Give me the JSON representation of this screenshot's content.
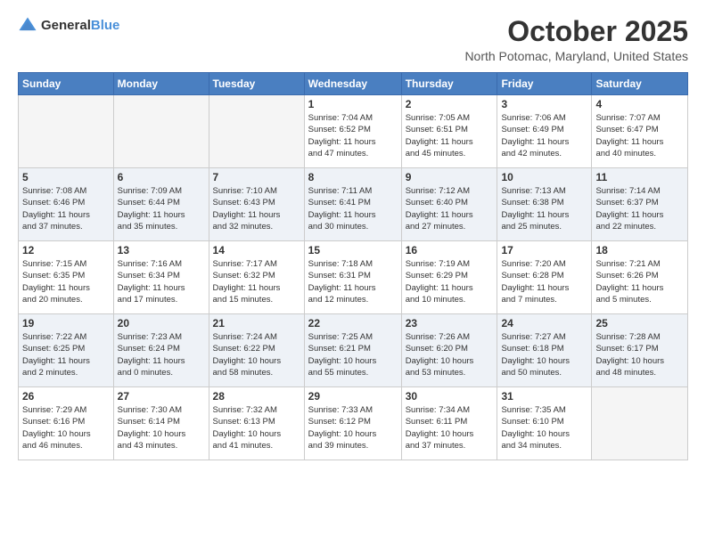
{
  "header": {
    "logo_general": "General",
    "logo_blue": "Blue",
    "month": "October 2025",
    "location": "North Potomac, Maryland, United States"
  },
  "weekdays": [
    "Sunday",
    "Monday",
    "Tuesday",
    "Wednesday",
    "Thursday",
    "Friday",
    "Saturday"
  ],
  "weeks": [
    [
      {
        "day": "",
        "info": ""
      },
      {
        "day": "",
        "info": ""
      },
      {
        "day": "",
        "info": ""
      },
      {
        "day": "1",
        "info": "Sunrise: 7:04 AM\nSunset: 6:52 PM\nDaylight: 11 hours\nand 47 minutes."
      },
      {
        "day": "2",
        "info": "Sunrise: 7:05 AM\nSunset: 6:51 PM\nDaylight: 11 hours\nand 45 minutes."
      },
      {
        "day": "3",
        "info": "Sunrise: 7:06 AM\nSunset: 6:49 PM\nDaylight: 11 hours\nand 42 minutes."
      },
      {
        "day": "4",
        "info": "Sunrise: 7:07 AM\nSunset: 6:47 PM\nDaylight: 11 hours\nand 40 minutes."
      }
    ],
    [
      {
        "day": "5",
        "info": "Sunrise: 7:08 AM\nSunset: 6:46 PM\nDaylight: 11 hours\nand 37 minutes."
      },
      {
        "day": "6",
        "info": "Sunrise: 7:09 AM\nSunset: 6:44 PM\nDaylight: 11 hours\nand 35 minutes."
      },
      {
        "day": "7",
        "info": "Sunrise: 7:10 AM\nSunset: 6:43 PM\nDaylight: 11 hours\nand 32 minutes."
      },
      {
        "day": "8",
        "info": "Sunrise: 7:11 AM\nSunset: 6:41 PM\nDaylight: 11 hours\nand 30 minutes."
      },
      {
        "day": "9",
        "info": "Sunrise: 7:12 AM\nSunset: 6:40 PM\nDaylight: 11 hours\nand 27 minutes."
      },
      {
        "day": "10",
        "info": "Sunrise: 7:13 AM\nSunset: 6:38 PM\nDaylight: 11 hours\nand 25 minutes."
      },
      {
        "day": "11",
        "info": "Sunrise: 7:14 AM\nSunset: 6:37 PM\nDaylight: 11 hours\nand 22 minutes."
      }
    ],
    [
      {
        "day": "12",
        "info": "Sunrise: 7:15 AM\nSunset: 6:35 PM\nDaylight: 11 hours\nand 20 minutes."
      },
      {
        "day": "13",
        "info": "Sunrise: 7:16 AM\nSunset: 6:34 PM\nDaylight: 11 hours\nand 17 minutes."
      },
      {
        "day": "14",
        "info": "Sunrise: 7:17 AM\nSunset: 6:32 PM\nDaylight: 11 hours\nand 15 minutes."
      },
      {
        "day": "15",
        "info": "Sunrise: 7:18 AM\nSunset: 6:31 PM\nDaylight: 11 hours\nand 12 minutes."
      },
      {
        "day": "16",
        "info": "Sunrise: 7:19 AM\nSunset: 6:29 PM\nDaylight: 11 hours\nand 10 minutes."
      },
      {
        "day": "17",
        "info": "Sunrise: 7:20 AM\nSunset: 6:28 PM\nDaylight: 11 hours\nand 7 minutes."
      },
      {
        "day": "18",
        "info": "Sunrise: 7:21 AM\nSunset: 6:26 PM\nDaylight: 11 hours\nand 5 minutes."
      }
    ],
    [
      {
        "day": "19",
        "info": "Sunrise: 7:22 AM\nSunset: 6:25 PM\nDaylight: 11 hours\nand 2 minutes."
      },
      {
        "day": "20",
        "info": "Sunrise: 7:23 AM\nSunset: 6:24 PM\nDaylight: 11 hours\nand 0 minutes."
      },
      {
        "day": "21",
        "info": "Sunrise: 7:24 AM\nSunset: 6:22 PM\nDaylight: 10 hours\nand 58 minutes."
      },
      {
        "day": "22",
        "info": "Sunrise: 7:25 AM\nSunset: 6:21 PM\nDaylight: 10 hours\nand 55 minutes."
      },
      {
        "day": "23",
        "info": "Sunrise: 7:26 AM\nSunset: 6:20 PM\nDaylight: 10 hours\nand 53 minutes."
      },
      {
        "day": "24",
        "info": "Sunrise: 7:27 AM\nSunset: 6:18 PM\nDaylight: 10 hours\nand 50 minutes."
      },
      {
        "day": "25",
        "info": "Sunrise: 7:28 AM\nSunset: 6:17 PM\nDaylight: 10 hours\nand 48 minutes."
      }
    ],
    [
      {
        "day": "26",
        "info": "Sunrise: 7:29 AM\nSunset: 6:16 PM\nDaylight: 10 hours\nand 46 minutes."
      },
      {
        "day": "27",
        "info": "Sunrise: 7:30 AM\nSunset: 6:14 PM\nDaylight: 10 hours\nand 43 minutes."
      },
      {
        "day": "28",
        "info": "Sunrise: 7:32 AM\nSunset: 6:13 PM\nDaylight: 10 hours\nand 41 minutes."
      },
      {
        "day": "29",
        "info": "Sunrise: 7:33 AM\nSunset: 6:12 PM\nDaylight: 10 hours\nand 39 minutes."
      },
      {
        "day": "30",
        "info": "Sunrise: 7:34 AM\nSunset: 6:11 PM\nDaylight: 10 hours\nand 37 minutes."
      },
      {
        "day": "31",
        "info": "Sunrise: 7:35 AM\nSunset: 6:10 PM\nDaylight: 10 hours\nand 34 minutes."
      },
      {
        "day": "",
        "info": ""
      }
    ]
  ]
}
